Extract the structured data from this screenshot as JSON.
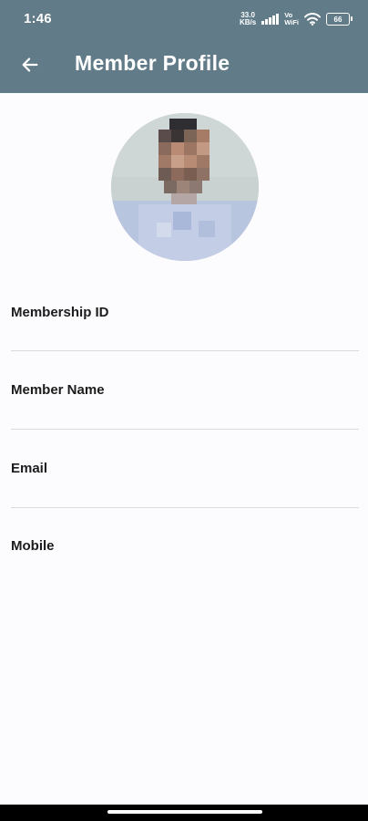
{
  "status_bar": {
    "time": "1:46",
    "net_speed_value": "33.0",
    "net_speed_unit": "KB/s",
    "volte_top": "Vo",
    "volte_bottom": "WiFi",
    "battery": "66"
  },
  "app_bar": {
    "title": "Member Profile",
    "back_icon": "arrow-left-icon"
  },
  "profile": {
    "avatar": "profile-photo"
  },
  "fields": [
    {
      "label": "Membership ID",
      "value": ""
    },
    {
      "label": "Member Name",
      "value": ""
    },
    {
      "label": "Email",
      "value": ""
    },
    {
      "label": "Mobile",
      "value": ""
    }
  ],
  "colors": {
    "app_bar": "#617b88",
    "background": "#fcfbfd",
    "divider": "#dadada"
  }
}
